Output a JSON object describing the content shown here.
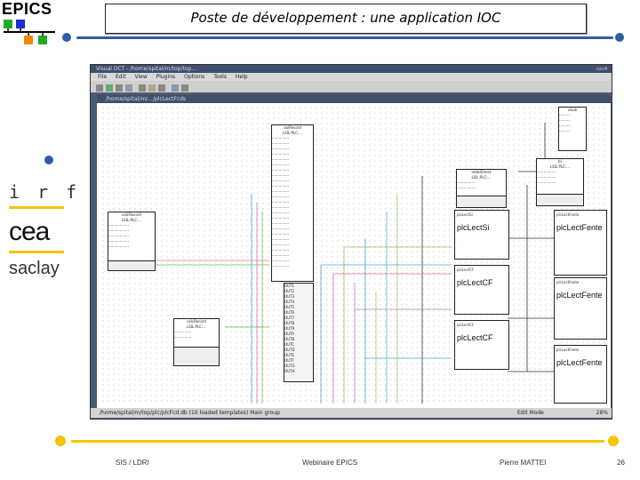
{
  "header": {
    "logo_text": "EPICS",
    "title": "Poste de développement : une application IOC"
  },
  "side_logos": {
    "irfu": "i r f u",
    "cea": "cea",
    "saclay": "saclay"
  },
  "screenshot": {
    "window_title": "Visual DCT - /home/spital/m/top/top...",
    "menu": [
      "File",
      "Edit",
      "View",
      "Plugins",
      "Options",
      "Tools",
      "Help"
    ],
    "inner_title": "/home/spital/m/.../plcLectFcds",
    "status_text": "/home/spital/m/top/plc/plcFcd.db (10 loaded templates)   Main group",
    "status_mode": "Edit Mode",
    "status_zoom": "28%",
    "records": {
      "plc_lect_si": "plcLectSi",
      "plc_lect_cf_1": "plcLectCF",
      "plc_lect_cf_2": "plcLectCF",
      "plc_lect_fente_1": "plcLectFente",
      "plc_lect_fente_2": "plcLectFente",
      "plc_lect_fente_3": "plcLectFente"
    }
  },
  "footer": {
    "left": "SIS / LDRI",
    "center": "Webinaire EPICS",
    "right": "Pierre MATTEI",
    "page": "26"
  },
  "colors": {
    "accent_blue": "#2a5caa",
    "accent_yellow": "#f4c400",
    "logo_green": "#22aa22",
    "logo_blue": "#1a2fd0",
    "logo_orange": "#ee8800"
  }
}
